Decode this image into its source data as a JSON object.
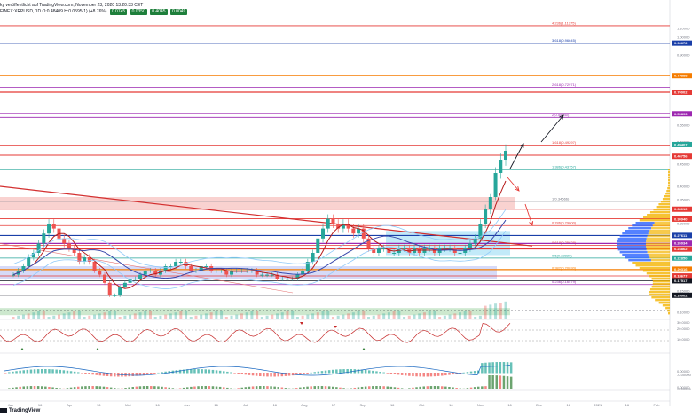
{
  "header": {
    "line1": "ky veröffentlicht auf TradingView.com, November 23, 2020 13:20:33 CET",
    "line2": "FINEX:XRPUSD, 1D  O:0.48409  H:0.0595(1)  (+8.76%)",
    "pills": [
      "0.0745",
      "0.0350",
      "0.4045",
      "0.0049"
    ]
  },
  "brand": "TradingView",
  "colors": {
    "candle_up": "#26a69a",
    "candle_down": "#ef5350",
    "fib_red": "#e53935",
    "fib_purple": "#9c27b0",
    "fib_blue": "#1a3fa8",
    "fib_orange": "#f57c00",
    "trendline": "#d32f2f",
    "volume_profile": "#f4b400",
    "volume_profile_blue": "#2962ff"
  },
  "chart_data": {
    "type": "candlestick",
    "symbol": "XRPUSD",
    "timeframe": "1D",
    "x_ticks": [
      "Jan",
      "16",
      "Apr",
      "16",
      "Mai",
      "16",
      "Jun",
      "16",
      "Jul",
      "16",
      "Aug",
      "17",
      "Sep",
      "16",
      "Okt",
      "16",
      "Nov",
      "16",
      "Dez",
      "16",
      "2021",
      "16",
      "Feb"
    ],
    "fib_levels": [
      {
        "label": "4.236(1.11275)",
        "value": 1.11275,
        "color": "#e53935"
      },
      {
        "label": "3.618(0.96645)",
        "value": 0.96645,
        "color": "#1a3fa8"
      },
      {
        "label": "2.618(0.72971)",
        "value": 0.72971,
        "color": "#9c27b0"
      },
      {
        "label": "2(0.58340)",
        "value": 0.5834,
        "color": "#9c27b0"
      },
      {
        "label": "1.618(0.49297)",
        "value": 0.49297,
        "color": "#e53935"
      },
      {
        "label": "1.386(0.43757)",
        "value": 0.43757,
        "color": "#26a69a"
      },
      {
        "label": "1(0.34666)",
        "value": 0.34666,
        "color": "#787b86"
      },
      {
        "label": "0.786(0.29600)",
        "value": 0.296,
        "color": "#e53935"
      },
      {
        "label": "0.618(0.25628)",
        "value": 0.25628,
        "color": "#e53935"
      },
      {
        "label": "0.5(0.22829)",
        "value": 0.22829,
        "color": "#26a69a"
      },
      {
        "label": "0.382(0.20030)",
        "value": 0.2003,
        "color": "#f57c00"
      },
      {
        "label": "0.236(0.16579)",
        "value": 0.16579,
        "color": "#9c27b0"
      }
    ],
    "price_axis": [
      "1.10000",
      "1.00000",
      "0.90000",
      "0.80000",
      "0.70000",
      "0.60000",
      "0.55000",
      "0.50000",
      "0.45000",
      "0.40000",
      "0.35000",
      "0.30000",
      "0.25000",
      "0.20000",
      "0.15000",
      "0.10000"
    ],
    "price_tags": [
      {
        "value": "0.96672",
        "color": "#1a3fa8"
      },
      {
        "value": "0.79888",
        "color": "#f57c00"
      },
      {
        "value": "0.70002",
        "color": "#e53935"
      },
      {
        "value": "0.59893",
        "color": "#9c27b0"
      },
      {
        "value": "0.49407",
        "color": "#26a69a"
      },
      {
        "value": "0.46756",
        "color": "#e53935"
      },
      {
        "value": "0.33010",
        "color": "#e53935"
      },
      {
        "value": "0.30940",
        "color": "#e53935"
      },
      {
        "value": "0.27611",
        "color": "#1a3fa8"
      },
      {
        "value": "0.26034",
        "color": "#9c27b0"
      },
      {
        "value": "0.24862",
        "color": "#e53935"
      },
      {
        "value": "0.22850",
        "color": "#26a69a"
      },
      {
        "value": "0.20316",
        "color": "#f57c00"
      },
      {
        "value": "0.18677",
        "color": "#e53935"
      },
      {
        "value": "0.17517",
        "color": "#131722"
      },
      {
        "value": "0.14002",
        "color": "#131722"
      }
    ],
    "indicator_axis": [
      "30.0000",
      "20.0000",
      "10.0000",
      "0.00000",
      "-0.00000",
      "0.00000",
      "-0.00000"
    ],
    "candles": [
      0.19,
      0.2,
      0.21,
      0.23,
      0.24,
      0.26,
      0.28,
      0.3,
      0.29,
      0.27,
      0.26,
      0.25,
      0.24,
      0.22,
      0.23,
      0.22,
      0.2,
      0.19,
      0.17,
      0.14,
      0.14,
      0.16,
      0.17,
      0.18,
      0.18,
      0.19,
      0.2,
      0.2,
      0.19,
      0.2,
      0.21,
      0.21,
      0.22,
      0.22,
      0.21,
      0.2,
      0.2,
      0.21,
      0.21,
      0.2,
      0.2,
      0.2,
      0.19,
      0.2,
      0.2,
      0.2,
      0.2,
      0.2,
      0.19,
      0.19,
      0.19,
      0.19,
      0.18,
      0.18,
      0.18,
      0.18,
      0.19,
      0.2,
      0.22,
      0.24,
      0.27,
      0.29,
      0.31,
      0.3,
      0.29,
      0.3,
      0.29,
      0.28,
      0.29,
      0.27,
      0.25,
      0.24,
      0.25,
      0.25,
      0.24,
      0.24,
      0.25,
      0.25,
      0.24,
      0.25,
      0.24,
      0.25,
      0.25,
      0.24,
      0.25,
      0.25,
      0.25,
      0.24,
      0.24,
      0.25,
      0.26,
      0.27,
      0.3,
      0.33,
      0.36,
      0.43,
      0.46,
      0.48
    ]
  }
}
